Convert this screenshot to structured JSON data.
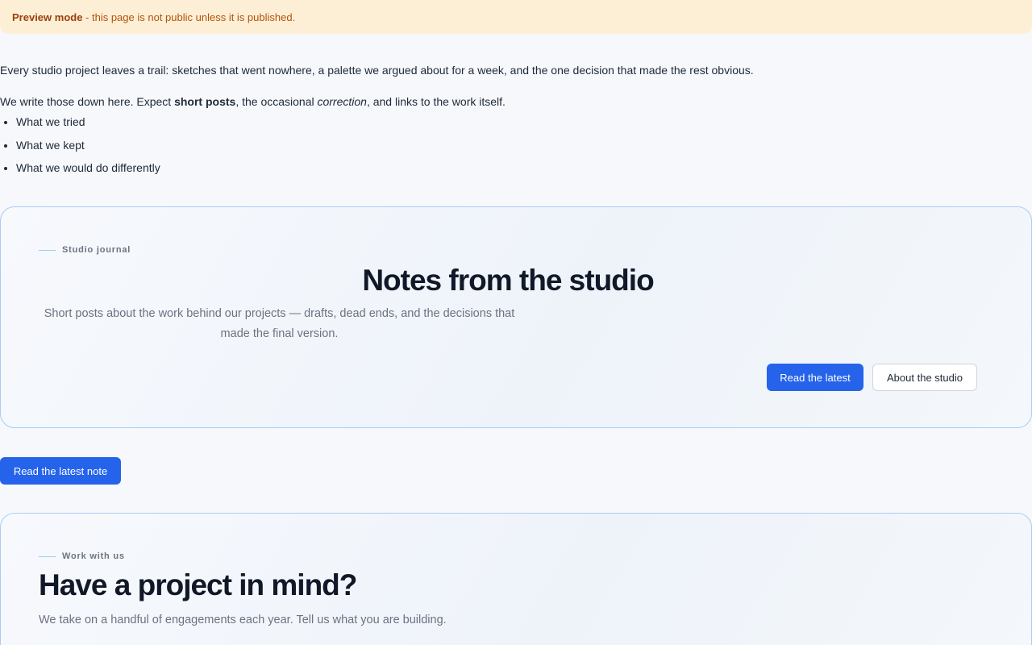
{
  "banner": {
    "label": "Preview mode",
    "message": " - this page is not public unless it is published."
  },
  "intro": {
    "paragraph1": "Every studio project leaves a trail: sketches that went nowhere, a palette we argued about for a week, and the one decision that made the rest obvious.",
    "p2_before": "We write those down here. Expect ",
    "p2_bold": "short posts",
    "p2_middle": ", the occasional ",
    "p2_italic": "correction",
    "p2_after": ", and links to the work itself.",
    "list": [
      "What we tried",
      "What we kept",
      "What we would do differently"
    ]
  },
  "hero": {
    "eyebrow": "Studio journal",
    "title": "Notes from the studio",
    "subtitle": "Short posts about the work behind our projects — drafts, dead ends, and the decisions that made the final version.",
    "primary_button": "Read the latest",
    "secondary_button": "About the studio"
  },
  "standalone_button": "Read the latest note",
  "cta": {
    "eyebrow": "Work with us",
    "title": "Have a project in mind?",
    "subtitle": "We take on a handful of engagements each year. Tell us what you are building."
  },
  "colors": {
    "accent": "#2563eb",
    "banner_bg": "#fdefd6",
    "banner_text": "#b45309",
    "card_border": "#a9cdf2",
    "page_bg": "#f6f8fc"
  }
}
